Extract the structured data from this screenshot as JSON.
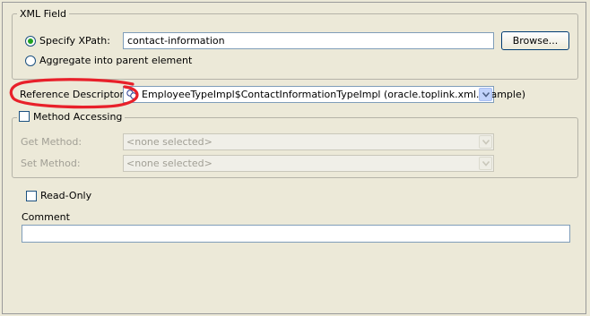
{
  "xml_field": {
    "legend": "XML Field",
    "specify_xpath_label": "Specify XPath:",
    "xpath_value": "contact-information",
    "browse_label": "Browse...",
    "aggregate_label": "Aggregate into parent element"
  },
  "reference_descriptor": {
    "label": "Reference Descriptor:",
    "value": "EmployeeTypeImpl$ContactInformationTypeImpl (oracle.toplink.xml.example)"
  },
  "method_accessing": {
    "label": "Method Accessing",
    "get_method_label": "Get Method:",
    "get_method_value": "<none selected>",
    "set_method_label": "Set Method:",
    "set_method_value": "<none selected>"
  },
  "read_only_label": "Read-Only",
  "comment": {
    "label": "Comment",
    "value": ""
  },
  "colors": {
    "annotation": "#e8202a",
    "window_bg": "#ece9d8"
  }
}
